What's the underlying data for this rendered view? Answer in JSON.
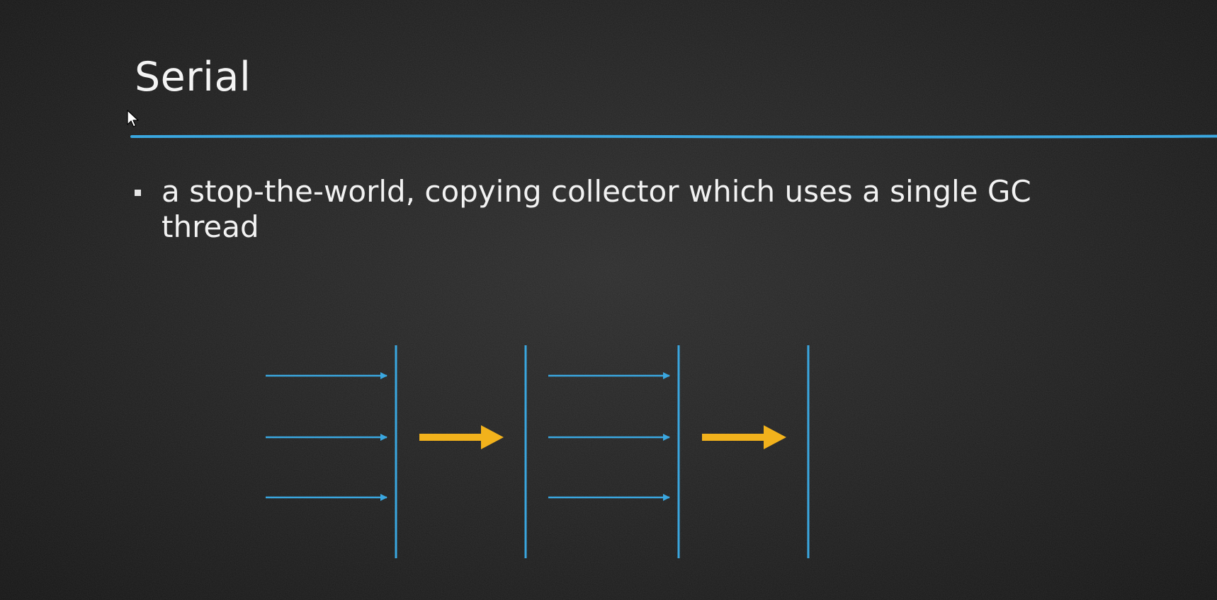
{
  "slide": {
    "title": "Serial",
    "bullets": [
      {
        "text": "a stop-the-world, copying collector which uses a single GC thread"
      }
    ]
  },
  "diagram": {
    "phases": [
      {
        "name": "application-threads-1",
        "arrow_count": 3
      },
      {
        "name": "gc-thread-1",
        "arrow_count": 1
      },
      {
        "name": "application-threads-2",
        "arrow_count": 3
      },
      {
        "name": "gc-thread-2",
        "arrow_count": 1
      }
    ],
    "barrier_count": 4,
    "colors": {
      "thread_arrow": "#3aa7e0",
      "gc_arrow": "#f2b21c",
      "barrier": "#3aa7e0",
      "title_rule": "#3aa7e0"
    }
  },
  "icons": {
    "cursor": "mouse-pointer-icon",
    "bullet": "square-bullet-icon"
  }
}
